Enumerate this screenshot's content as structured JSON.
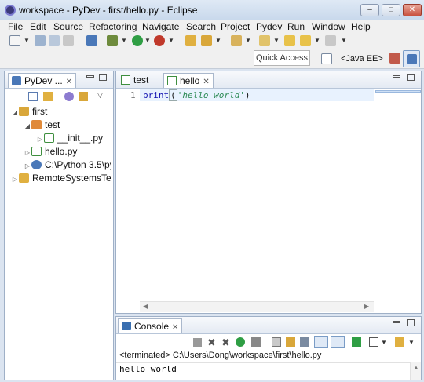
{
  "window": {
    "title": "workspace - PyDev - first/hello.py - Eclipse",
    "buttons": [
      "–",
      "□",
      "✕"
    ]
  },
  "menu": [
    "File",
    "Edit",
    "Source",
    "Refactoring",
    "Navigate",
    "Search",
    "Project",
    "Pydev",
    "Run",
    "Window",
    "Help"
  ],
  "quick_access": "Quick Access",
  "perspective": "<Java EE>",
  "explorer": {
    "tab": "PyDev ...",
    "items": [
      {
        "label": "first"
      },
      {
        "label": "test"
      },
      {
        "label": "__init__.py"
      },
      {
        "label": "hello.py"
      },
      {
        "label": "C:\\Python 3.5\\py"
      },
      {
        "label": "RemoteSystemsTem"
      }
    ]
  },
  "editor": {
    "tabs": [
      "test",
      "hello"
    ],
    "line_number": "1",
    "code": {
      "fn": "print",
      "open": "(",
      "str": "'hello world'",
      "close": ")"
    }
  },
  "console": {
    "tab": "Console",
    "status": "<terminated> C:\\Users\\Dong\\workspace\\first\\hello.py",
    "output": "hello world"
  },
  "colors": {
    "accent": "#3a6fb0",
    "string": "#2e8b57",
    "keyword": "#1010b0"
  }
}
